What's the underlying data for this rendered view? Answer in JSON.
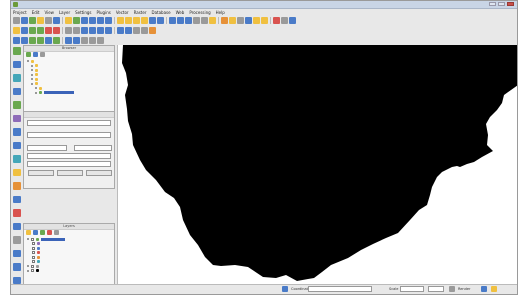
{
  "window": {
    "title": ""
  },
  "menu": [
    "Project",
    "Edit",
    "View",
    "Layer",
    "Settings",
    "Plugins",
    "Vector",
    "Raster",
    "Database",
    "Web",
    "Processing",
    "Help"
  ],
  "toolbars": {
    "row1": [
      "ico-gr",
      "ico-b",
      "ico-g",
      "ico-y",
      "ico-gr",
      "ico-b",
      "ico-y",
      "ico-g",
      "ico-b",
      "ico-b",
      "ico-b",
      "ico-b",
      "ico-y",
      "ico-y",
      "ico-y",
      "ico-y",
      "ico-b",
      "ico-b",
      "ico-b",
      "ico-b",
      "ico-b",
      "ico-gr",
      "ico-gr",
      "ico-y",
      "ico-o",
      "ico-y",
      "ico-gr",
      "ico-b",
      "ico-y",
      "ico-y",
      "ico-r",
      "ico-gr",
      "ico-b"
    ],
    "row2": [
      "ico-y",
      "ico-b",
      "ico-g",
      "ico-g",
      "ico-r",
      "ico-r",
      "ico-gr",
      "ico-gr",
      "ico-b",
      "ico-b",
      "ico-b",
      "ico-b",
      "ico-b",
      "ico-b",
      "ico-gr",
      "ico-gr",
      "ico-o"
    ],
    "row3": [
      "ico-b",
      "ico-b",
      "ico-g",
      "ico-g",
      "ico-b",
      "ico-g",
      "ico-b",
      "ico-b",
      "ico-gr",
      "ico-gr",
      "ico-gr"
    ]
  },
  "side_toolbar": [
    "ico-g",
    "ico-b",
    "ico-c",
    "ico-b",
    "ico-g",
    "ico-p",
    "ico-b",
    "ico-b",
    "ico-c",
    "ico-y",
    "ico-o",
    "ico-b",
    "ico-r",
    "ico-b",
    "ico-gr",
    "ico-b",
    "ico-b",
    "ico-b"
  ],
  "layers_panel": {
    "title": "Browser"
  },
  "process_panel": {
    "title": "",
    "btn_a": "",
    "btn_b": "",
    "btn_c": "",
    "dropdown": ""
  },
  "legend_panel": {
    "title": "Layers"
  },
  "statusbar": {
    "coordinate_label": "Coordinate",
    "scale_label": "Scale",
    "render_label": "Render"
  }
}
